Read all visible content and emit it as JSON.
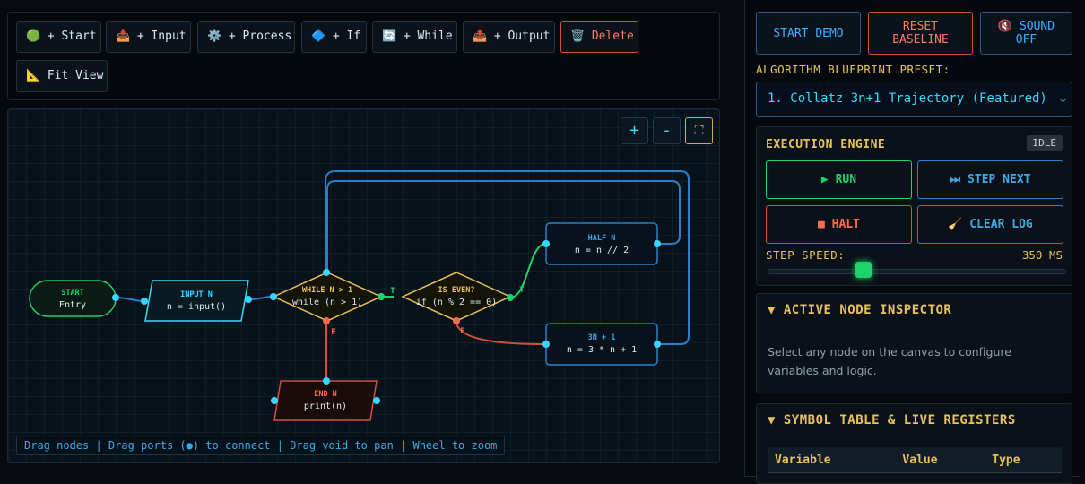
{
  "toolbar": {
    "buttons": [
      {
        "icon": "🟢",
        "icon_name": "green-circle-icon",
        "label": "+ Start"
      },
      {
        "icon": "📥",
        "icon_name": "inbox-tray-icon",
        "label": "+ Input"
      },
      {
        "icon": "⚙️",
        "icon_name": "gear-icon",
        "label": "+ Process"
      },
      {
        "icon": "🔷",
        "icon_name": "blue-diamond-icon",
        "label": "+ If"
      },
      {
        "icon": "🔄",
        "icon_name": "loop-arrows-icon",
        "label": "+ While"
      },
      {
        "icon": "📤",
        "icon_name": "outbox-tray-icon",
        "label": "+ Output"
      },
      {
        "icon": "🗑️",
        "icon_name": "trash-icon",
        "label": "Delete"
      },
      {
        "icon": "📐",
        "icon_name": "triangle-ruler-icon",
        "label": "Fit View"
      }
    ]
  },
  "canvas": {
    "zoom_in": "+",
    "zoom_out": "-",
    "fit_icon": "⛶",
    "hint": "Drag nodes | Drag ports (●) to connect | Drag void to pan | Wheel to zoom",
    "nodes": {
      "start": {
        "title": "START",
        "code": "Entry"
      },
      "input": {
        "title": "INPUT N",
        "code": "n = input()"
      },
      "while": {
        "title": "WHILE N > 1",
        "code": "while (n > 1)"
      },
      "if": {
        "title": "IS EVEN?",
        "code": "if (n % 2 == 0)"
      },
      "half": {
        "title": "HALF N",
        "code": "n = n // 2"
      },
      "triple": {
        "title": "3N + 1",
        "code": "n = 3 * n + 1"
      },
      "end": {
        "title": "END N",
        "code": "print(n)"
      }
    },
    "edge_labels": {
      "while_true": "T",
      "while_false": "F",
      "if_true": "T",
      "if_false": "F"
    }
  },
  "colors": {
    "accent_cyan": "#35d9ff",
    "accent_yellow": "#e8c25a",
    "green": "#1ed26a",
    "red": "#d0503c",
    "blue": "#2a7fc9"
  },
  "side": {
    "start_demo": "START DEMO",
    "reset_baseline": "RESET BASELINE",
    "sound_icon": "🔇",
    "sound_label": "SOUND OFF",
    "preset_label": "ALGORITHM BLUEPRINT PRESET:",
    "preset_value": "1. Collatz 3n+1 Trajectory (Featured)",
    "engine": {
      "title": "EXECUTION ENGINE",
      "status": "IDLE",
      "run": "▶ RUN",
      "step_next": "⏭ STEP NEXT",
      "halt": "■ HALT",
      "clear_log": "🧹 CLEAR LOG",
      "speed_label": "STEP SPEED:",
      "speed_value": "350 MS"
    },
    "inspector": {
      "title": "▼ ACTIVE NODE INSPECTOR",
      "text": "Select any node on the canvas to configure variables and logic."
    },
    "symbols": {
      "title": "▼ SYMBOL TABLE & LIVE REGISTERS",
      "columns": [
        "Variable",
        "Value",
        "Type"
      ]
    }
  }
}
